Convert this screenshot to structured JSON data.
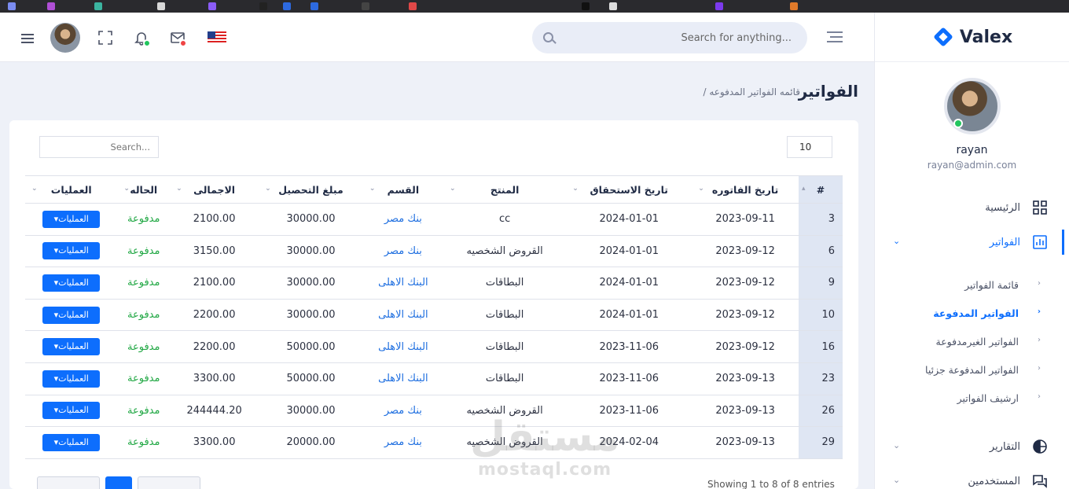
{
  "app": {
    "logo_text": "Valex"
  },
  "header": {
    "search_placeholder": "Search for anything...",
    "icons": [
      "flag-usa-icon",
      "mail-icon",
      "bell-icon",
      "fullscreen-icon",
      "avatar",
      "menu-icon"
    ]
  },
  "sidebar": {
    "user_name": "rayan",
    "user_email": "rayan@admin.com",
    "items": [
      {
        "label": "الرئيسية",
        "icon": "grid-icon"
      },
      {
        "label": "الفواتير",
        "icon": "chart-icon"
      },
      {
        "label": "التقارير",
        "icon": "pie-icon"
      },
      {
        "label": "المستخدمين",
        "icon": "chat-icon"
      }
    ],
    "sub_items": [
      {
        "label": "قائمة الفواتير"
      },
      {
        "label": "الفواتير المدفوعة"
      },
      {
        "label": "الفواتير الغيرمدفوعة"
      },
      {
        "label": "الفواتير المدفوعة جزئيا"
      },
      {
        "label": "ارشيف الفواتير"
      }
    ]
  },
  "page": {
    "title": "الفواتير",
    "breadcrumb": "/ قائمه الفواتير المدفوعه"
  },
  "table": {
    "length_value": "10",
    "search_placeholder": "Search...",
    "columns": [
      "#",
      "تاريخ الفاتوره",
      "تاريخ الاستحقاق",
      "المنتج",
      "القسم",
      "مبلغ التحصيل",
      "الاجمالى",
      "الحاله",
      "العمليات"
    ],
    "button_label": "العمليات▾",
    "rows": [
      {
        "id": "3",
        "invoice_date": "2023-09-11",
        "due_date": "2024-01-01",
        "product": "cc",
        "dept": "بنك مصر",
        "collection": "30000.00",
        "total": "2100.00",
        "status": "مدفوعة"
      },
      {
        "id": "6",
        "invoice_date": "2023-09-12",
        "due_date": "2024-01-01",
        "product": "القروض الشخصيه",
        "dept": "بنك مصر",
        "collection": "30000.00",
        "total": "3150.00",
        "status": "مدفوعة"
      },
      {
        "id": "9",
        "invoice_date": "2023-09-12",
        "due_date": "2024-01-01",
        "product": "البطاقات",
        "dept": "البنك الاهلى",
        "collection": "30000.00",
        "total": "2100.00",
        "status": "مدفوعة"
      },
      {
        "id": "10",
        "invoice_date": "2023-09-12",
        "due_date": "2024-01-01",
        "product": "البطاقات",
        "dept": "البنك الاهلى",
        "collection": "30000.00",
        "total": "2200.00",
        "status": "مدفوعة"
      },
      {
        "id": "16",
        "invoice_date": "2023-09-12",
        "due_date": "2023-11-06",
        "product": "البطاقات",
        "dept": "البنك الاهلى",
        "collection": "50000.00",
        "total": "2200.00",
        "status": "مدفوعة"
      },
      {
        "id": "23",
        "invoice_date": "2023-09-13",
        "due_date": "2023-11-06",
        "product": "البطاقات",
        "dept": "البنك الاهلى",
        "collection": "50000.00",
        "total": "3300.00",
        "status": "مدفوعة"
      },
      {
        "id": "26",
        "invoice_date": "2023-09-13",
        "due_date": "2023-11-06",
        "product": "القروض الشخصيه",
        "dept": "بنك مصر",
        "collection": "30000.00",
        "total": "244444.20",
        "status": "مدفوعة"
      },
      {
        "id": "29",
        "invoice_date": "2023-09-13",
        "due_date": "2024-02-04",
        "product": "القروض الشخصيه",
        "dept": "بنك مصر",
        "collection": "20000.00",
        "total": "3300.00",
        "status": "مدفوعة"
      }
    ],
    "footer_info": "Showing 1 to 8 of 8 entries"
  },
  "watermark": {
    "arabic": "مستقل",
    "latin": "mostaql.com"
  },
  "colors": {
    "accent": "#0d6efd",
    "paid": "#22a845",
    "dept_link": "#1f6fe0"
  }
}
